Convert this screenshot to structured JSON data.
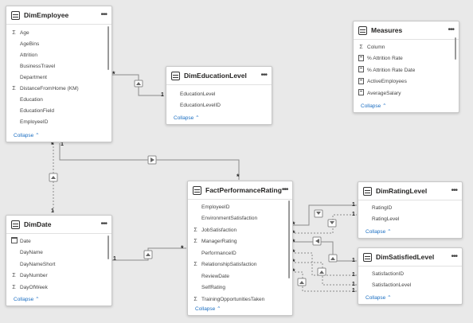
{
  "tables": {
    "dim_employee": {
      "title": "DimEmployee",
      "fields": [
        {
          "name": "Age",
          "icon": "sigma"
        },
        {
          "name": "AgeBins",
          "icon": "none"
        },
        {
          "name": "Attrition",
          "icon": "none"
        },
        {
          "name": "BusinessTravel",
          "icon": "none"
        },
        {
          "name": "Department",
          "icon": "none"
        },
        {
          "name": "DistanceFromHome (KM)",
          "icon": "sigma"
        },
        {
          "name": "Education",
          "icon": "none"
        },
        {
          "name": "EducationField",
          "icon": "none"
        },
        {
          "name": "EmployeeID",
          "icon": "none"
        }
      ],
      "collapse": "Collapse"
    },
    "dim_education_level": {
      "title": "DimEducationLevel",
      "fields": [
        {
          "name": "EducationLevel",
          "icon": "none"
        },
        {
          "name": "EducationLevelID",
          "icon": "none"
        }
      ],
      "collapse": "Collapse"
    },
    "measures": {
      "title": "Measures",
      "fields": [
        {
          "name": "Column",
          "icon": "sigma"
        },
        {
          "name": "% Attrition Rate",
          "icon": "calc"
        },
        {
          "name": "% Attrition Rate Date",
          "icon": "calc"
        },
        {
          "name": "ActiveEmployees",
          "icon": "calc"
        },
        {
          "name": "AverageSalary",
          "icon": "calc"
        }
      ],
      "collapse": "Collapse"
    },
    "fact_performance_rating": {
      "title": "FactPerformanceRating",
      "fields": [
        {
          "name": "EmployeeID",
          "icon": "none"
        },
        {
          "name": "EnvironmentSatisfaction",
          "icon": "none"
        },
        {
          "name": "JobSatisfaction",
          "icon": "sigma"
        },
        {
          "name": "ManagerRating",
          "icon": "sigma"
        },
        {
          "name": "PerformanceID",
          "icon": "none"
        },
        {
          "name": "RelationshipSatisfaction",
          "icon": "sigma"
        },
        {
          "name": "ReviewDate",
          "icon": "none"
        },
        {
          "name": "SelfRating",
          "icon": "none"
        },
        {
          "name": "TrainingOpportunitiesTaken",
          "icon": "sigma"
        }
      ],
      "collapse": "Collapse"
    },
    "dim_date": {
      "title": "DimDate",
      "fields": [
        {
          "name": "Date",
          "icon": "calendar"
        },
        {
          "name": "DayName",
          "icon": "none"
        },
        {
          "name": "DayNameShort",
          "icon": "none"
        },
        {
          "name": "DayNumber",
          "icon": "sigma"
        },
        {
          "name": "DayOfWeek",
          "icon": "sigma"
        }
      ],
      "collapse": "Collapse"
    },
    "dim_rating_level": {
      "title": "DimRatingLevel",
      "fields": [
        {
          "name": "RatingID",
          "icon": "none"
        },
        {
          "name": "RatingLevel",
          "icon": "none"
        }
      ],
      "collapse": "Collapse"
    },
    "dim_satisfied_level": {
      "title": "DimSatisfiedLevel",
      "fields": [
        {
          "name": "SatisfactionID",
          "icon": "none"
        },
        {
          "name": "SatisfactionLevel",
          "icon": "none"
        }
      ],
      "collapse": "Collapse"
    }
  },
  "cardinality": {
    "many": "*",
    "one": "1"
  },
  "icons": {
    "more": "ellipsis-icon",
    "sigma": "Σ"
  },
  "colors": {
    "canvas": "#e9e9e9",
    "line": "#8a8a8a",
    "link": "#1b6ec2"
  }
}
